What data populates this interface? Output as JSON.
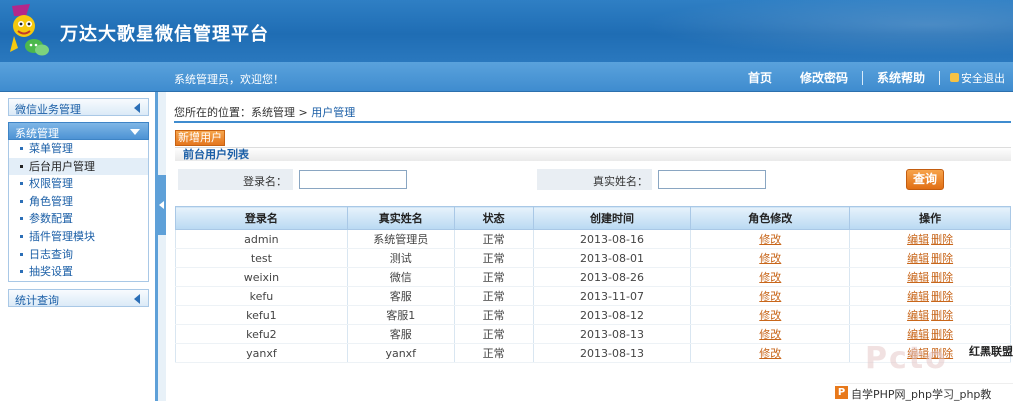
{
  "header": {
    "title": "万达大歌星微信管理平台"
  },
  "navbar": {
    "welcome": "系统管理员，欢迎您！",
    "links": [
      "首页",
      "修改密码",
      "系统帮助"
    ],
    "logout": "安全退出"
  },
  "sidebar": {
    "groups": {
      "wechat": "微信业务管理",
      "system": "系统管理",
      "stats": "统计查询"
    },
    "items": [
      "菜单管理",
      "后台用户管理",
      "权限管理",
      "角色管理",
      "参数配置",
      "插件管理模块",
      "日志查询",
      "抽奖设置"
    ],
    "active_item": "后台用户管理"
  },
  "breadcrumb": {
    "prefix": "您所在的位置：",
    "parent": "系统管理",
    "sep": " > ",
    "current": "用户管理"
  },
  "toolbar": {
    "add_label": "新增用户"
  },
  "list": {
    "title": "前台用户列表"
  },
  "search": {
    "login_label": "登录名：",
    "login_value": "",
    "realname_label": "真实姓名：",
    "realname_value": "",
    "button": "查询"
  },
  "table": {
    "columns": [
      "登录名",
      "真实姓名",
      "状态",
      "创建时间",
      "角色修改",
      "操作"
    ],
    "edit_role_label": "修改",
    "edit_label": "编辑",
    "delete_label": "删除",
    "rows": [
      {
        "login": "admin",
        "name": "系统管理员",
        "status": "正常",
        "created": "2013-08-16"
      },
      {
        "login": "test",
        "name": "测试",
        "status": "正常",
        "created": "2013-08-01"
      },
      {
        "login": "weixin",
        "name": "微信",
        "status": "正常",
        "created": "2013-08-26"
      },
      {
        "login": "kefu",
        "name": "客服",
        "status": "正常",
        "created": "2013-11-07"
      },
      {
        "login": "kefu1",
        "name": "客服1",
        "status": "正常",
        "created": "2013-08-12"
      },
      {
        "login": "kefu2",
        "name": "客服",
        "status": "正常",
        "created": "2013-08-13"
      },
      {
        "login": "yanxf",
        "name": "yanxf",
        "status": "正常",
        "created": "2013-08-13"
      }
    ]
  },
  "watermark": {
    "logo": "Pcto",
    "brand": "红黑联盟",
    "icon": "P",
    "strip": "自学PHP网_php学习_php教"
  },
  "colors": {
    "header": "#1f6db4",
    "accent": "#e4761e",
    "link": "#c8661a"
  }
}
